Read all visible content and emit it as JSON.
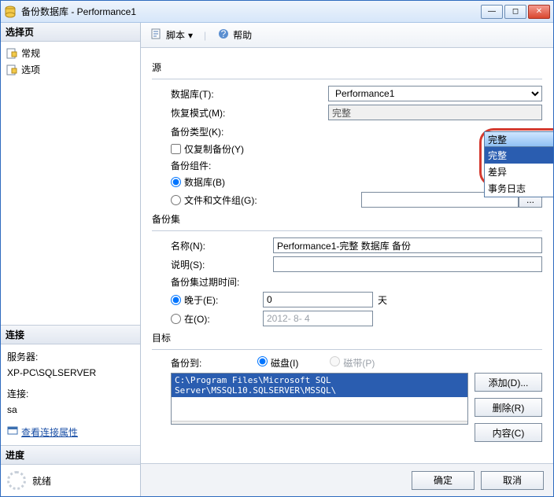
{
  "window": {
    "title": "备份数据库 - Performance1"
  },
  "sidebar": {
    "select_page": "选择页",
    "items": [
      "常规",
      "选项"
    ],
    "connection_hdr": "连接",
    "server_lbl": "服务器:",
    "server_val": "XP-PC\\SQLSERVER",
    "conn_lbl": "连接:",
    "conn_val": "sa",
    "view_props": "查看连接属性",
    "progress_hdr": "进度",
    "ready": "就绪"
  },
  "toolbar": {
    "script": "脚本",
    "help": "帮助"
  },
  "src": {
    "section": "源",
    "database_lbl": "数据库(T):",
    "database_val": "Performance1",
    "recovery_lbl": "恢复模式(M):",
    "recovery_val": "完整",
    "type_lbl": "备份类型(K):",
    "type_val": "完整",
    "type_opts": [
      "完整",
      "差异",
      "事务日志"
    ],
    "copy_only": "仅复制备份(Y)",
    "component_lbl": "备份组件:",
    "comp_db": "数据库(B)",
    "comp_fg": "文件和文件组(G):"
  },
  "set": {
    "section": "备份集",
    "name_lbl": "名称(N):",
    "name_val": "Performance1-完整 数据库 备份",
    "desc_lbl": "说明(S):",
    "desc_val": "",
    "expire_lbl": "备份集过期时间:",
    "after_lbl": "晚于(E):",
    "after_val": "0",
    "after_unit": "天",
    "on_lbl": "在(O):",
    "on_val": "2012- 8- 4"
  },
  "dest": {
    "section": "目标",
    "to_lbl": "备份到:",
    "disk": "磁盘(I)",
    "tape": "磁带(P)",
    "path": "C:\\Program Files\\Microsoft SQL Server\\MSSQL10.SQLSERVER\\MSSQL\\",
    "add": "添加(D)...",
    "remove": "删除(R)",
    "contents": "内容(C)"
  },
  "footer": {
    "ok": "确定",
    "cancel": "取消"
  }
}
